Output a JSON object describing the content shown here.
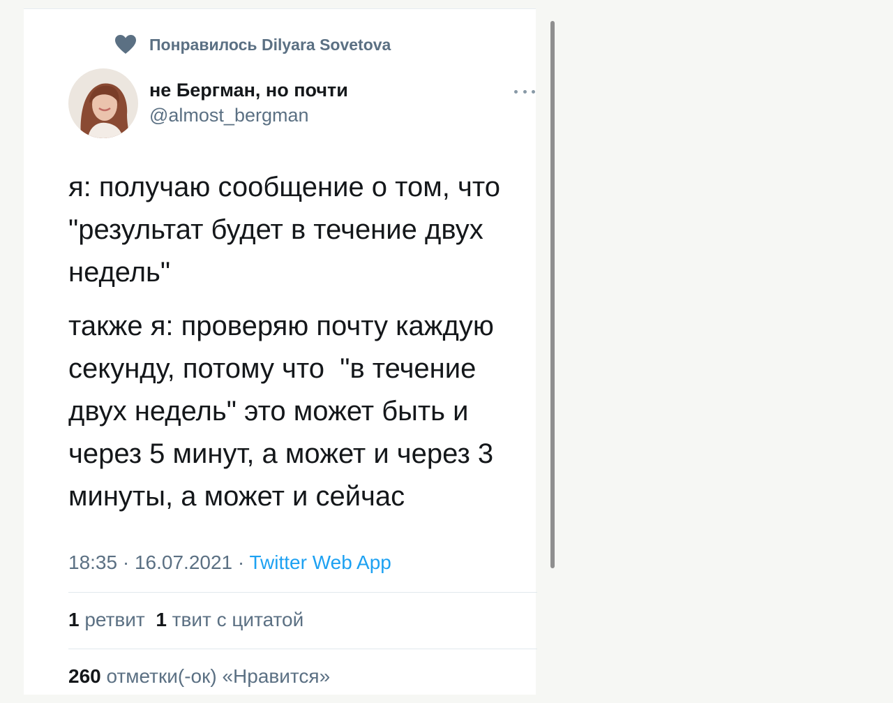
{
  "colors": {
    "primary_text": "#14171a",
    "secondary_text": "#5b7083",
    "link": "#1da1f2",
    "divider": "#e1e8ed"
  },
  "social_context": {
    "icon": "heart-icon",
    "text": "Понравилось Dilyara Sovetova"
  },
  "author": {
    "name": "не Бергман, но почти",
    "handle": "@almost_bergman"
  },
  "more_menu": {
    "icon": "more-dots-icon"
  },
  "tweet": {
    "paragraph_1": "я: получаю сообщение о том, что \"результат будет в течение двух недель\"",
    "paragraph_2": "также я: проверяю почту каждую секунду, потому что  \"в течение двух недель\" это может быть и через 5 минут, а может и через 3 минуты, а может и сейчас"
  },
  "meta": {
    "time": "18:35",
    "separator": " · ",
    "date": "16.07.2021",
    "source": "Twitter Web App"
  },
  "stats": {
    "retweets_count": "1",
    "retweets_label": "ретвит",
    "quotes_count": "1",
    "quotes_label": "твит с цитатой",
    "likes_count": "260",
    "likes_label": "отметки(-ок) «Нравится»"
  }
}
